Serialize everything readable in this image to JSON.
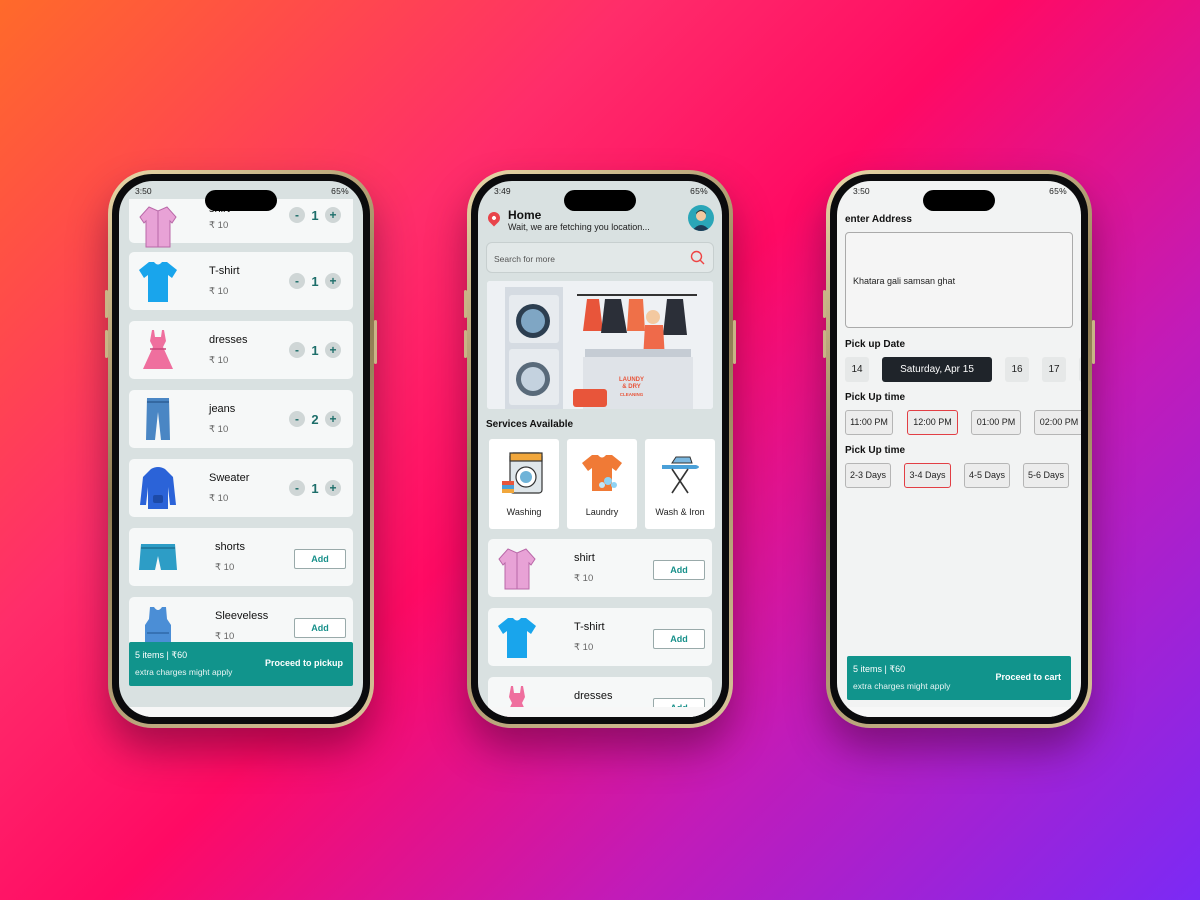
{
  "status_bars": [
    {
      "time": "3:50",
      "right": "65%"
    },
    {
      "time": "3:49",
      "right": "65%"
    },
    {
      "time": "3:50",
      "right": "65%"
    }
  ],
  "cart_screen": {
    "currency_price": "₹ 10",
    "items": [
      {
        "name": "shirt",
        "price": "₹ 10",
        "qty": "1",
        "image": "shirt-icon"
      },
      {
        "name": "T-shirt",
        "price": "₹ 10",
        "qty": "1",
        "image": "tshirt-icon"
      },
      {
        "name": "dresses",
        "price": "₹ 10",
        "qty": "1",
        "image": "dress-icon"
      },
      {
        "name": "jeans",
        "price": "₹ 10",
        "qty": "2",
        "image": "jeans-icon"
      },
      {
        "name": "Sweater",
        "price": "₹ 10",
        "qty": "1",
        "image": "sweater-icon"
      },
      {
        "name": "shorts",
        "price": "₹ 10",
        "action": "Add",
        "image": "shorts-icon"
      },
      {
        "name": "Sleeveless",
        "price": "₹ 10",
        "action": "Add",
        "image": "sleeveless-icon"
      }
    ],
    "stepper": {
      "minus": "-",
      "plus": "+"
    },
    "cart_bar": {
      "summary": "5 items | ₹60",
      "note": "extra charges might apply",
      "button": "Proceed to pickup"
    }
  },
  "home_screen": {
    "title": "Home",
    "subtitle": "Wait, we are fetching you location...",
    "search_placeholder": "Search for more",
    "banner_text": [
      "LAUNDY",
      "& DRY",
      "CLEANING"
    ],
    "services_title": "Services Available",
    "services": [
      {
        "label": "Washing",
        "icon": "washing-machine-icon"
      },
      {
        "label": "Laundry",
        "icon": "laundry-shirt-icon"
      },
      {
        "label": "Wash & Iron",
        "icon": "ironing-board-icon"
      }
    ],
    "items": [
      {
        "name": "shirt",
        "price": "₹ 10",
        "action": "Add"
      },
      {
        "name": "T-shirt",
        "price": "₹ 10",
        "action": "Add"
      },
      {
        "name": "dresses",
        "price": "",
        "action": "Add"
      }
    ]
  },
  "order_screen": {
    "address_label": "enter Address",
    "address_value": "Khatara gali samsan ghat",
    "pickup_date_label": "Pick up Date",
    "dates": [
      "14",
      "Saturday, Apr 15",
      "16",
      "17"
    ],
    "selected_date": "Saturday, Apr 15",
    "pickup_time_label": "Pick Up time",
    "times": [
      "11:00 PM",
      "12:00 PM",
      "01:00 PM",
      "02:00 PM"
    ],
    "selected_time": "12:00 PM",
    "duration_label": "Pick Up time",
    "durations": [
      "2-3 Days",
      "3-4 Days",
      "4-5 Days",
      "5-6 Days"
    ],
    "selected_duration": "3-4 Days",
    "cart_bar": {
      "summary": "5 items | ₹60",
      "note": "extra charges might apply",
      "button": "Proceed to cart"
    }
  },
  "colors": {
    "accent": "#11948c",
    "selected_border": "#e23e44",
    "dark_chip": "#1f242a"
  }
}
